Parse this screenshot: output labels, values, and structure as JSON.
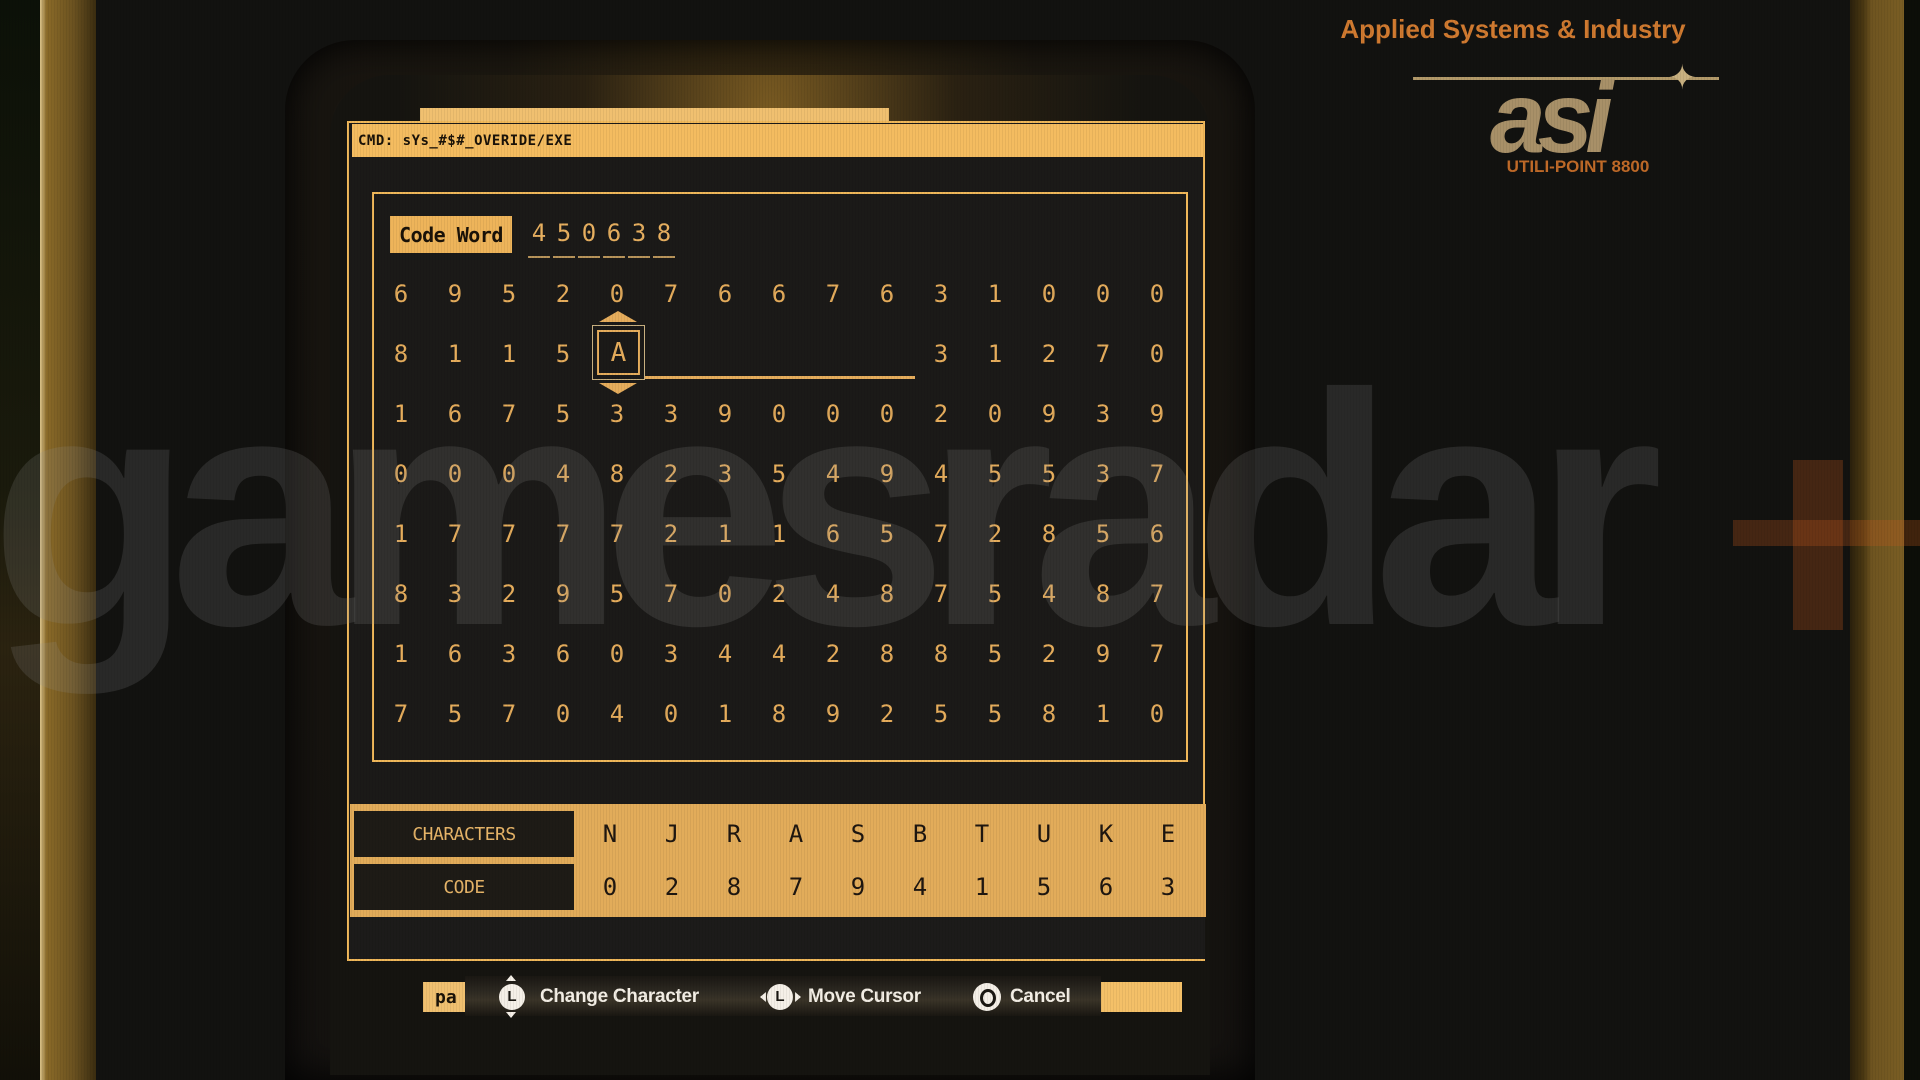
{
  "terminal": {
    "command_label": "CMD: sYs_#$#_OVERIDE/EXE",
    "code_word_label": "Code Word",
    "code_word_digits": [
      "4",
      "5",
      "0",
      "6",
      "3",
      "8"
    ],
    "grid": [
      [
        "6",
        "9",
        "5",
        "2",
        "0",
        "7",
        "6",
        "6",
        "7",
        "6",
        "3",
        "1",
        "0",
        "0",
        "0"
      ],
      [
        "8",
        "1",
        "1",
        "5",
        "",
        "",
        "",
        "",
        "",
        "",
        "3",
        "1",
        "2",
        "7",
        "0"
      ],
      [
        "1",
        "6",
        "7",
        "5",
        "3",
        "3",
        "9",
        "0",
        "0",
        "0",
        "2",
        "0",
        "9",
        "3",
        "9"
      ],
      [
        "0",
        "0",
        "0",
        "4",
        "8",
        "2",
        "3",
        "5",
        "4",
        "9",
        "4",
        "5",
        "5",
        "3",
        "7"
      ],
      [
        "1",
        "7",
        "7",
        "7",
        "7",
        "2",
        "1",
        "1",
        "6",
        "5",
        "7",
        "2",
        "8",
        "5",
        "6"
      ],
      [
        "8",
        "3",
        "2",
        "9",
        "5",
        "7",
        "0",
        "2",
        "4",
        "8",
        "7",
        "5",
        "4",
        "8",
        "7"
      ],
      [
        "1",
        "6",
        "3",
        "6",
        "0",
        "3",
        "4",
        "4",
        "2",
        "8",
        "8",
        "5",
        "2",
        "9",
        "7"
      ],
      [
        "7",
        "5",
        "7",
        "0",
        "4",
        "0",
        "1",
        "8",
        "9",
        "2",
        "5",
        "5",
        "8",
        "1",
        "0"
      ]
    ],
    "cursor": {
      "row": 2,
      "column": 5,
      "character": "A"
    },
    "key_table": {
      "characters_label": "CHARACTERS",
      "code_label": "CODE",
      "characters": [
        "N",
        "J",
        "R",
        "A",
        "S",
        "B",
        "T",
        "U",
        "K",
        "E"
      ],
      "codes": [
        "0",
        "2",
        "8",
        "7",
        "9",
        "4",
        "1",
        "5",
        "6",
        "3"
      ]
    }
  },
  "footer": {
    "tab_left_text": "pa",
    "prompts": [
      {
        "button": "L",
        "icon": "left-stick-up-down",
        "label": "Change Character"
      },
      {
        "button": "L",
        "icon": "left-stick-left-right",
        "label": "Move Cursor"
      },
      {
        "button": "O",
        "icon": "circle-button",
        "label": "Cancel"
      }
    ]
  },
  "branding": {
    "company": "Applied Systems & Industry",
    "logo": "asi",
    "model": "UTILI-POINT 8800"
  },
  "watermark": {
    "text": "gamesradar",
    "plus": "+"
  },
  "colors": {
    "amber": "#f0b85a",
    "amber_text": "#e6ad5c",
    "screen_bg": "#1b1a18",
    "logo_orange": "#d07a30"
  }
}
